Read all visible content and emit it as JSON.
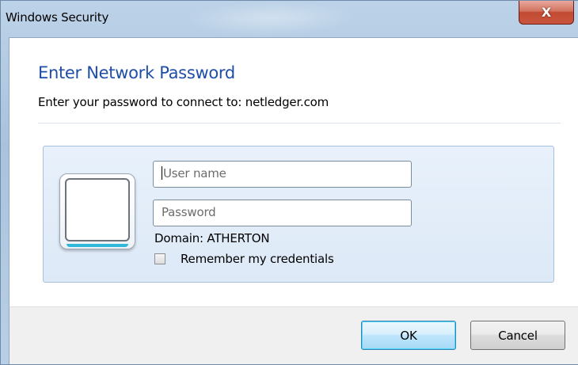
{
  "window": {
    "title": "Windows Security",
    "close_label": "X"
  },
  "dialog": {
    "heading": "Enter Network Password",
    "subtext": "Enter your password to connect to: netledger.com"
  },
  "credentials": {
    "username_placeholder": "User name",
    "password_placeholder": "Password",
    "domain_text": "Domain: ATHERTON",
    "remember_label": "Remember my credentials",
    "remember_checked": false
  },
  "buttons": {
    "ok": "OK",
    "cancel": "Cancel"
  },
  "colors": {
    "heading": "#1f4ea8",
    "close_button": "#c24b34",
    "default_button_border": "#3c7fb1"
  }
}
